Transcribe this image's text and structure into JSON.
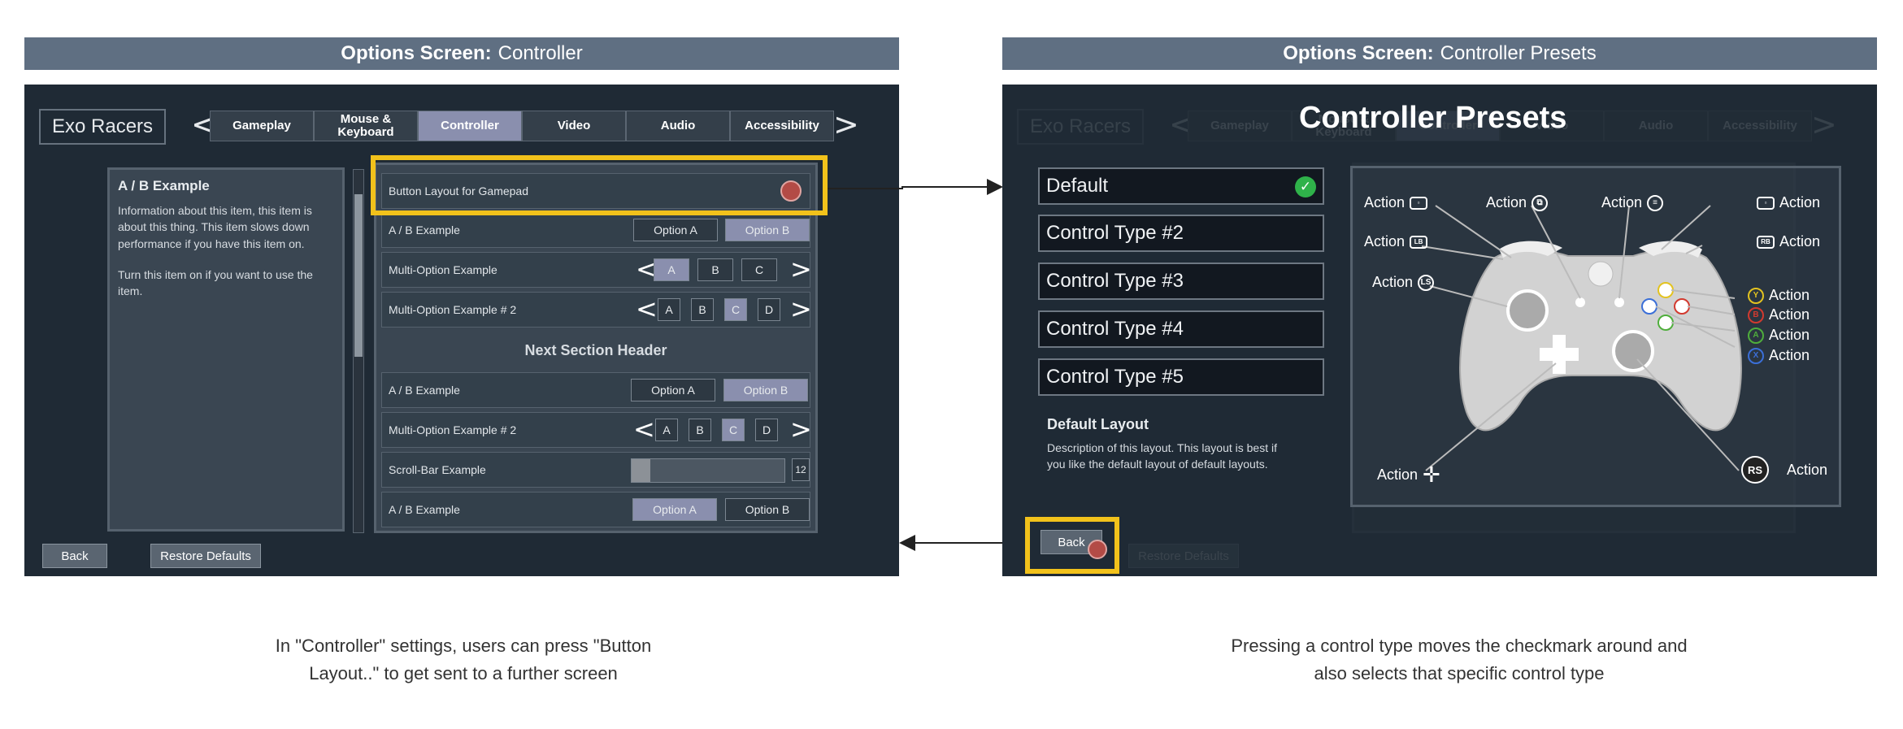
{
  "left": {
    "header_bold": "Options Screen:",
    "header_rest": "Controller",
    "game_title": "Exo Racers",
    "tabs": [
      {
        "label": "Gameplay"
      },
      {
        "label": "Mouse & Keyboard"
      },
      {
        "label": "Controller"
      },
      {
        "label": "Video"
      },
      {
        "label": "Audio"
      },
      {
        "label": "Accessibility"
      }
    ],
    "active_tab": "Controller",
    "description": {
      "title": "A / B Example",
      "body1": "Information about this item, this item is about this thing. This item slows down performance if you have this item on.",
      "body2": "Turn this item on if you want to use the item."
    },
    "rows": {
      "button_layout": "Button Layout for Gamepad",
      "ab1": {
        "label": "A / B Example",
        "opt_a": "Option A",
        "opt_b": "Option B",
        "selected": "Option B"
      },
      "multi1": {
        "label": "Multi-Option Example",
        "options": [
          "A",
          "B",
          "C"
        ],
        "selected": "A"
      },
      "multi2": {
        "label": "Multi-Option Example # 2",
        "options": [
          "A",
          "B",
          "C",
          "D"
        ],
        "selected": "C"
      },
      "section_header": "Next Section Header",
      "ab2": {
        "label": "A / B Example",
        "opt_a": "Option A",
        "opt_b": "Option B",
        "selected": "Option B"
      },
      "multi3": {
        "label": "Multi-Option Example # 2",
        "options": [
          "A",
          "B",
          "C",
          "D"
        ],
        "selected": "C"
      },
      "scroll": {
        "label": "Scroll-Bar Example",
        "value": "12",
        "fraction": 0.12
      },
      "ab3": {
        "label": "A / B Example",
        "opt_a": "Option A",
        "opt_b": "Option B",
        "selected": "Option A"
      }
    },
    "footer": {
      "back": "Back",
      "restore": "Restore Defaults"
    },
    "caption": "In \"Controller\" settings, users can press \"Button Layout..\" to get sent to a further screen"
  },
  "right": {
    "header_bold": "Options Screen:",
    "header_rest": "Controller Presets",
    "overlay_title": "Controller Presets",
    "presets": [
      {
        "label": "Default",
        "checked": true
      },
      {
        "label": "Control Type #2",
        "checked": false
      },
      {
        "label": "Control Type #3",
        "checked": false
      },
      {
        "label": "Control Type #4",
        "checked": false
      },
      {
        "label": "Control Type #5",
        "checked": false
      }
    ],
    "layout_desc": {
      "title": "Default Layout",
      "body": "Description of this layout. This layout is best if you like the default layout of default layouts."
    },
    "back": "Back",
    "action_label": "Action",
    "glyphs": {
      "lb": "LB",
      "ls": "LS",
      "rb": "RB",
      "rs": "RS",
      "y": "Y",
      "b": "B",
      "a": "A",
      "x": "X"
    },
    "face_colors": {
      "y": "#e3c320",
      "b": "#d23a2f",
      "a": "#4fae3c",
      "x": "#3b6fd8"
    },
    "caption": "Pressing a control type moves the checkmark around and also selects that specific control type"
  },
  "colors": {
    "highlight": "#f2c21b",
    "selected": "#8a8fae",
    "panel": "#1f2a35",
    "header": "#5f6f82"
  }
}
